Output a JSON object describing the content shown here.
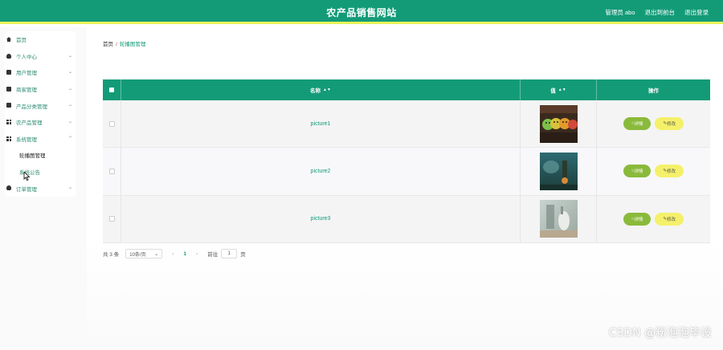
{
  "header": {
    "title": "农产品销售网站",
    "admin": "管理员 abo",
    "to_front": "退出到前台",
    "logout": "退出登录"
  },
  "sidebar": {
    "items": [
      {
        "label": "首页",
        "icon": "home-icon",
        "expandable": false
      },
      {
        "label": "个人中心",
        "icon": "user-icon",
        "expandable": true
      },
      {
        "label": "用户管理",
        "icon": "clipboard-icon",
        "expandable": true
      },
      {
        "label": "商家管理",
        "icon": "list-icon",
        "expandable": true
      },
      {
        "label": "产品分类管理",
        "icon": "clipboard-icon",
        "expandable": true
      },
      {
        "label": "农产品管理",
        "icon": "grid-icon",
        "expandable": true
      },
      {
        "label": "系统管理",
        "icon": "grid-icon",
        "expandable": true
      }
    ],
    "sub_items": [
      "轮播图管理",
      "系统公告"
    ],
    "last_item": {
      "label": "订单管理",
      "icon": "user-icon"
    }
  },
  "breadcrumb": {
    "home": "首页",
    "separator": "/",
    "current": "轮播图管理"
  },
  "table": {
    "columns": [
      "名称",
      "值",
      "操作"
    ],
    "rows": [
      {
        "name": "picture1",
        "detail": "详情",
        "edit": "修改"
      },
      {
        "name": "picture2",
        "detail": "详情",
        "edit": "修改"
      },
      {
        "name": "picture3",
        "detail": "详情",
        "edit": "修改"
      }
    ]
  },
  "pagination": {
    "total": "共 3 条",
    "page_size": "10条/页",
    "current_page": "1",
    "goto_label": "前往",
    "goto_value": "1",
    "page_unit": "页"
  },
  "watermark": "CSDN @粉泡泡毕设",
  "colors": {
    "primary": "#139b78",
    "accent_bar": "#e8f35a",
    "detail_button": "#8aba3b",
    "edit_button": "#f5f06a"
  }
}
